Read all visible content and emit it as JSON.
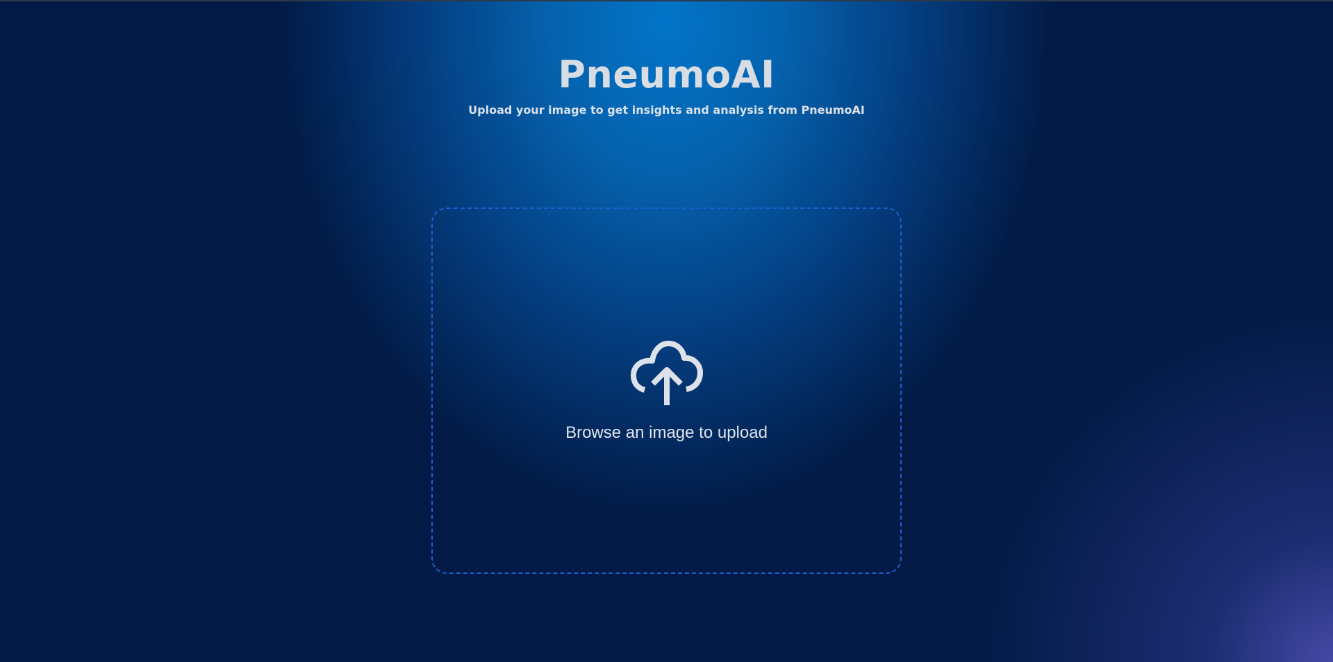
{
  "app": {
    "title": "PneumoAI",
    "subtitle": "Upload your image to get insights and analysis from PneumoAI"
  },
  "upload": {
    "label": "Browse an image to upload",
    "icon": "cloud-upload-icon"
  },
  "colors": {
    "accent": "#1c5fd0",
    "text": "#d8dde4",
    "background_center": "#0274c8",
    "background_edge": "#021a45",
    "corner_glow": "#484caa"
  }
}
